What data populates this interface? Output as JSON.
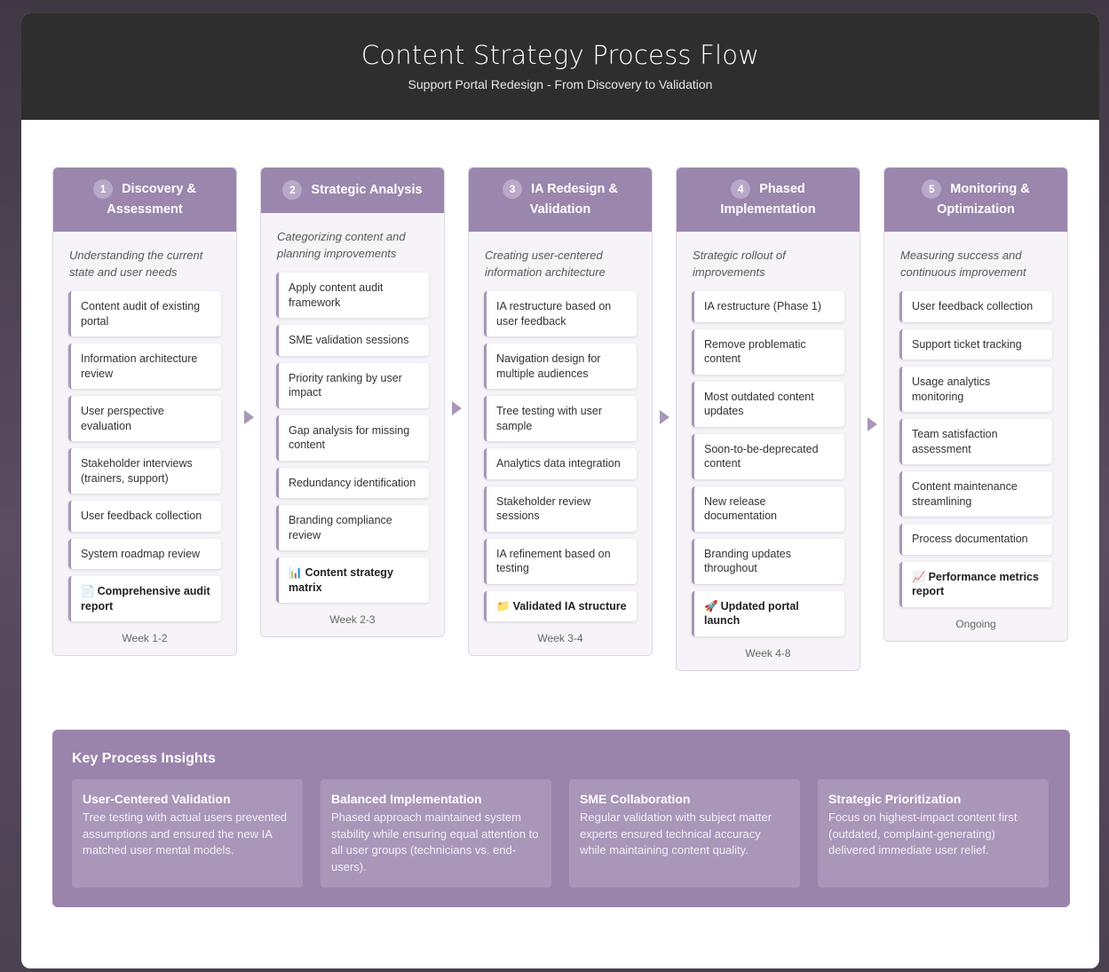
{
  "header": {
    "title": "Content Strategy Process Flow",
    "subtitle": "Support Portal Redesign - From Discovery to Validation"
  },
  "phases": [
    {
      "number": "1",
      "title": "Discovery & Assessment",
      "description": "Understanding the current state and user needs",
      "tasks": [
        "Content audit of existing portal",
        "Information architecture review",
        "User perspective evaluation",
        "Stakeholder interviews (trainers, support)",
        "User feedback collection",
        "System roadmap review"
      ],
      "deliverable_icon": "document-icon",
      "deliverable": "Comprehensive audit report",
      "timeline": "Week 1-2"
    },
    {
      "number": "2",
      "title": "Strategic Analysis",
      "description": "Categorizing content and planning improvements",
      "tasks": [
        "Apply content audit framework",
        "SME validation sessions",
        "Priority ranking by user impact",
        "Gap analysis for missing content",
        "Redundancy identification",
        "Branding compliance review"
      ],
      "deliverable_icon": "bar-chart-icon",
      "deliverable": "Content strategy matrix",
      "timeline": "Week 2-3"
    },
    {
      "number": "3",
      "title": "IA Redesign & Validation",
      "description": "Creating user-centered information architecture",
      "tasks": [
        "IA restructure based on user feedback",
        "Navigation design for multiple audiences",
        "Tree testing with user sample",
        "Analytics data integration",
        "Stakeholder review sessions",
        "IA refinement based on testing"
      ],
      "deliverable_icon": "folder-icon",
      "deliverable": "Validated IA structure",
      "timeline": "Week 3-4"
    },
    {
      "number": "4",
      "title": "Phased Implementation",
      "description": "Strategic rollout of improvements",
      "tasks": [
        "IA restructure (Phase 1)",
        "Remove problematic content",
        "Most outdated content updates",
        "Soon-to-be-deprecated content",
        "New release documentation",
        "Branding updates throughout"
      ],
      "deliverable_icon": "rocket-icon",
      "deliverable": "Updated portal launch",
      "timeline": "Week 4-8"
    },
    {
      "number": "5",
      "title": "Monitoring & Optimization",
      "description": "Measuring success and continuous improvement",
      "tasks": [
        "User feedback collection",
        "Support ticket tracking",
        "Usage analytics monitoring",
        "Team satisfaction assessment",
        "Content maintenance streamlining",
        "Process documentation"
      ],
      "deliverable_icon": "trend-chart-icon",
      "deliverable": "Performance metrics report",
      "timeline": "Ongoing"
    }
  ],
  "insights": {
    "title": "Key Process Insights",
    "items": [
      {
        "heading": "User-Centered Validation",
        "text": "Tree testing with actual users prevented assumptions and ensured the new IA matched user mental models."
      },
      {
        "heading": "Balanced Implementation",
        "text": "Phased approach maintained system stability while ensuring equal attention to all user groups (technicians vs. end-users)."
      },
      {
        "heading": "SME Collaboration",
        "text": "Regular validation with subject matter experts ensured technical accuracy while maintaining content quality."
      },
      {
        "heading": "Strategic Prioritization",
        "text": "Focus on highest-impact content first (outdated, complaint-generating) delivered immediate user relief."
      }
    ]
  },
  "colors": {
    "header_bg": "#2e2e2e",
    "accent": "#9b86ad",
    "accent_light": "#a897b7",
    "phase_bg": "#f6f4f8"
  }
}
